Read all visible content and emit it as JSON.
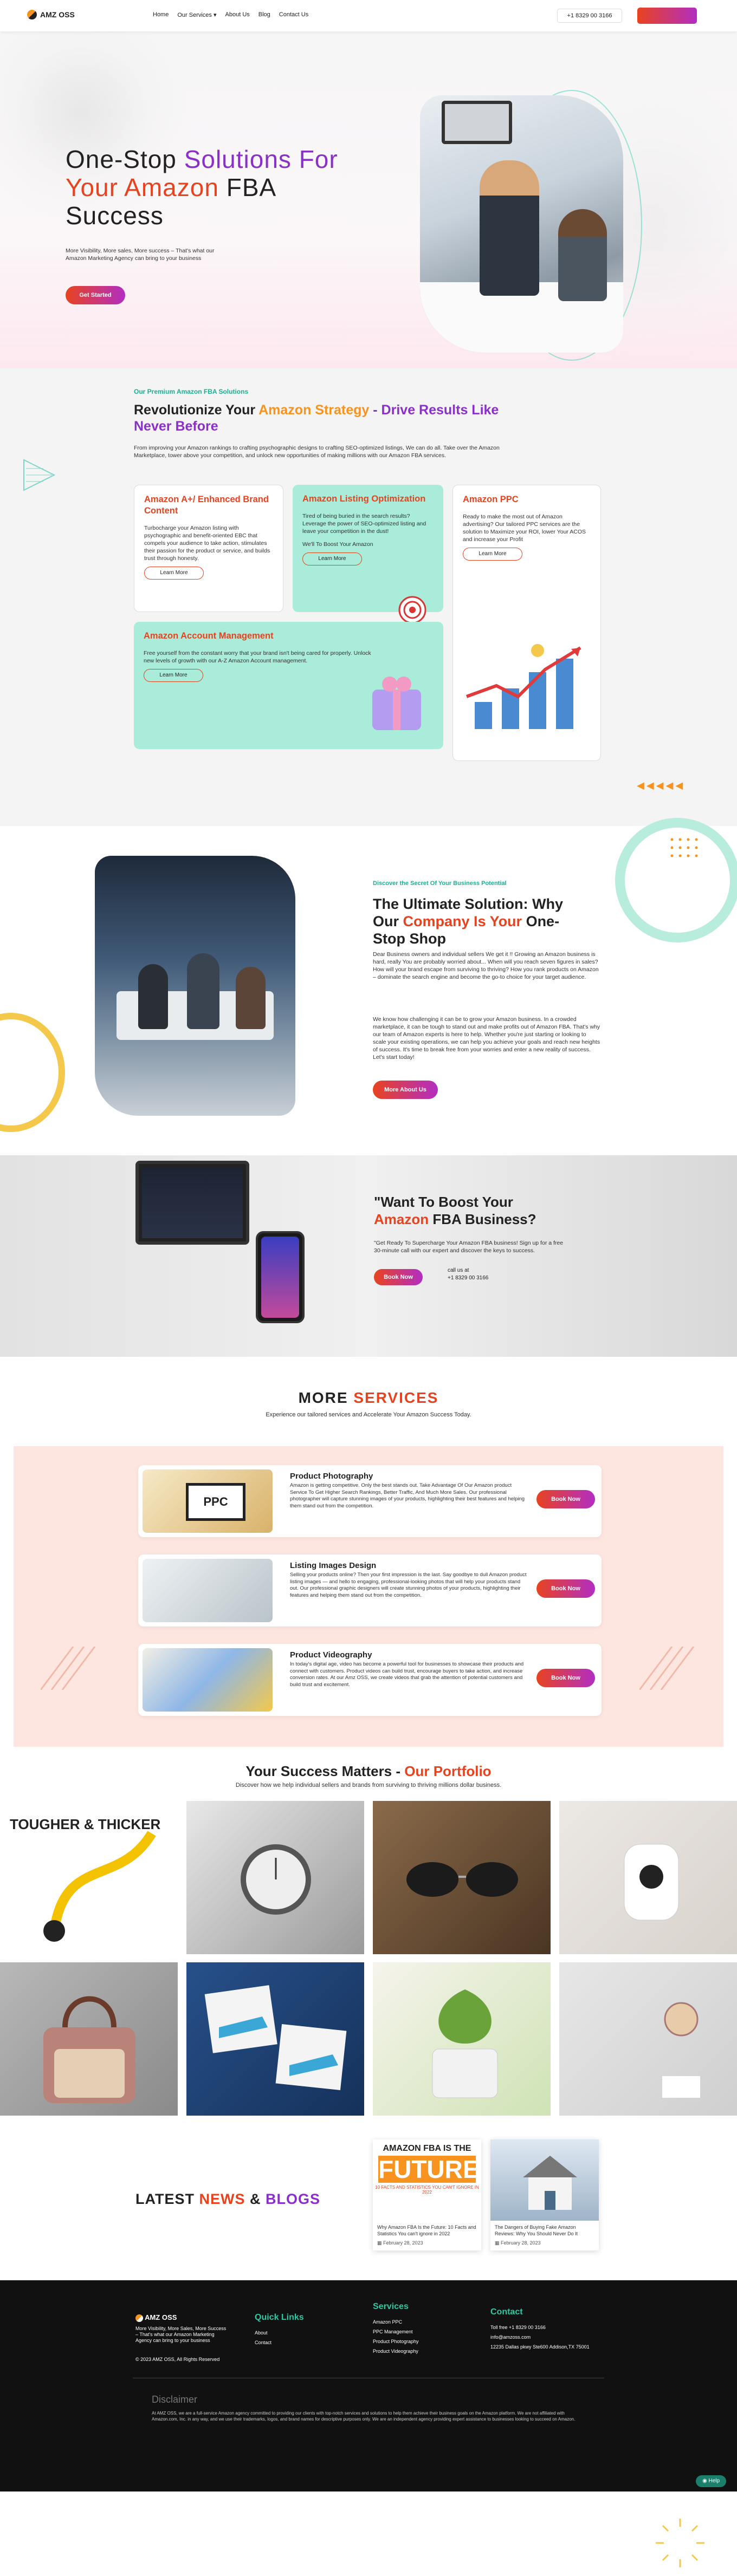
{
  "header": {
    "logo_text": "AMZ OSS",
    "nav": [
      "Home",
      "Our Services",
      "About Us",
      "Blog",
      "Contact Us"
    ],
    "phone": "+1 8329 00 3166",
    "cta": ""
  },
  "hero": {
    "title_l1a": "One-Stop ",
    "title_l1b": "Solutions For",
    "title_l2a": "Your Amazon ",
    "title_l2b": "FBA",
    "title_l3": "Success",
    "desc": "More Visibility, More sales, More success – That's what our Amazon Marketing Agency can bring to your business",
    "button": "Get Started"
  },
  "premium": {
    "eyebrow": "Our Premium Amazon FBA Solutions",
    "h_a": "Revolutionize Your ",
    "h_b": "Amazon Strategy",
    "h_c": " - Drive Results Like Never Before",
    "lead": "From improving your Amazon rankings to crafting psychographic designs to crafting SEO-optimized listings, We can do all. Take over the Amazon Marketplace, tower above your competition, and unlock new opportunities of making millions with our Amazon FBA services.",
    "cards": [
      {
        "title": "Amazon A+/ Enhanced Brand Content",
        "text": "Turbocharge your Amazon listing with psychographic and benefit-oriented EBC that compels your audience to take action, stimulates their passion for the product or service, and builds trust through honesty.",
        "button": "Learn More"
      },
      {
        "title": "Amazon Listing Optimization",
        "text": "Tired of being buried in the search results? Leverage the power of SEO-optimized listing and leave your competition in the dust!",
        "text2": "We'll To Boost Your Amazon",
        "button": "Learn More"
      },
      {
        "title": "Amazon PPC",
        "text": "Ready to make the most out of Amazon advertising? Our tailored PPC services are the solution to Maximize your ROI, lower Your ACOS and increase your Profit",
        "button": "Learn More"
      },
      {
        "title": "Amazon Account Management",
        "text": "Free yourself from the constant worry that your brand isn't being cared for properly. Unlock new levels of growth with our A-Z Amazon Account management.",
        "button": "Learn More"
      }
    ]
  },
  "solution": {
    "eyebrow": "Discover the Secret Of Your Business Potential",
    "h_a": "The Ultimate Solution: Why Our ",
    "h_b": "Company Is Your",
    "h_c": " One-Stop Shop",
    "p1": "Dear Business owners and individual sellers We get it !! Growing an Amazon business is hard, really You are probably worried about... When will you reach seven figures in sales? How will your brand escape from surviving to thriving? How you rank products on Amazon – dominate the search engine and become the go-to choice for your target audience.",
    "p2": "We know how challenging it can be to grow your Amazon business. In a crowded marketplace, it can be tough to stand out and make profits out of Amazon FBA. That's why our team of Amazon experts is here to help. Whether you're just starting or looking to scale your existing operations, we can help you achieve your goals and reach new heights of success. It's time to break free from your worries and enter a new reality of success. Let's start today!",
    "button": "More About Us"
  },
  "boost": {
    "h_a": "\"Want To Boost Your ",
    "h_b": "Amazon",
    "h_c": " FBA Business?",
    "text": "\"Get Ready To Supercharge Your Amazon FBA business! Sign up for a free 30-minute call with our expert and discover the keys to success.",
    "button": "Book Now",
    "call_label": "call us at",
    "phone": "+1 8329 00 3166"
  },
  "more_services": {
    "title_a": "MORE ",
    "title_b": "SERVICES",
    "sub": "Experience our tailored services and Accelerate Your Amazon Success Today.",
    "items": [
      {
        "title": "Product Photography",
        "text": "Amazon is getting competitive. Only the best stands out. Take Advantage Of Our Amazon product Service To Get Higher Search Rankings, Better Traffic, And Much More Sales. Our professional photographer will capture stunning images of your products, highlighting their best features and helping them stand out from the competition.",
        "button": "Book Now",
        "thumb": "PPC"
      },
      {
        "title": "Listing Images Design",
        "text": "Selling your products online? Then your first impression is the last. Say goodbye to dull Amazon product listing images — and hello to engaging, professional-looking photos that will help your products stand out. Our professional graphic designers will create stunning photos of your products, highlighting their features and helping them stand out from the competition.",
        "button": "Book Now"
      },
      {
        "title": "Product Videography",
        "text": "In today's digital age, video has become a powerful tool for businesses to showcase their products and connect with customers. Product videos can build trust, encourage buyers to take action, and increase conversion rates. At our Amz OSS, we create videos that grab the attention of potential customers and build trust and excitement.",
        "button": "Book Now"
      }
    ]
  },
  "portfolio": {
    "title_a": "Your Success Matters - ",
    "title_b": "Our Portfolio",
    "sub": "Discover how we help individual sellers and brands from surviving to thriving millions dollar business.",
    "tile1_text": "TOUGHER & THICKER",
    "tile_icons": [
      "cable-icon",
      "watch-icon",
      "sunglasses-icon",
      "camera-icon",
      "handbag-icon",
      "sneakers-icon",
      "cream-jar-icon",
      "wall-clock-icon"
    ]
  },
  "blogs": {
    "title_a": "LATEST ",
    "title_b": "NEWS",
    "title_c": " & ",
    "title_d": "BLOGS",
    "posts": [
      {
        "img_head": "AMAZON FBA IS THE",
        "img_big": "FUTURE",
        "img_sub": "10 FACTS AND STATISTICS YOU CAN'T IGNORE IN 2022",
        "text": "Why Amazon FBA Is the Future: 10 Facts and Statistics You can't ignore in 2022",
        "date": "February 28, 2023"
      },
      {
        "text": "The Dangers of Buying Fake Amazon Reviews: Why You Should Never Do It",
        "date": "February 28, 2023"
      }
    ]
  },
  "footer": {
    "logo_text": "AMZ OSS",
    "about": "More Visibility, More Sales, More Success – That's what our Amazon Marketing Agency can bring to your business",
    "copyright": "© 2023 AMZ OSS, All Rights Reserved",
    "quick_title": "Quick Links",
    "quick": [
      "About",
      "Contact"
    ],
    "services_title": "Services",
    "services": [
      "Amazon PPC",
      "PPC Management",
      "Product Photography",
      "Product Videography"
    ],
    "contact_title": "Contact",
    "contact": [
      "Toll free +1 8329 00 3166",
      "info@amzoss.com",
      "12235 Dallas pkwy Ste600 Addison,TX 75001"
    ],
    "disclaimer_title": "Disclaimer",
    "disclaimer": "At AMZ OSS, we are a full-service Amazon agency committed to providing our clients with top-notch services and solutions to help them achieve their business goals on the Amazon platform. We are not affiliated with Amazon.com, Inc. in any way, and we use their trademarks, logos, and brand names for descriptive purposes only. We are an independent agency providing expert assistance to businesses looking to succeed on Amazon.",
    "help": "Help"
  },
  "colors": {
    "orange": "#e8431f",
    "purple": "#8b2fc9",
    "mint": "#a9ecd9",
    "teal": "#17b193"
  }
}
